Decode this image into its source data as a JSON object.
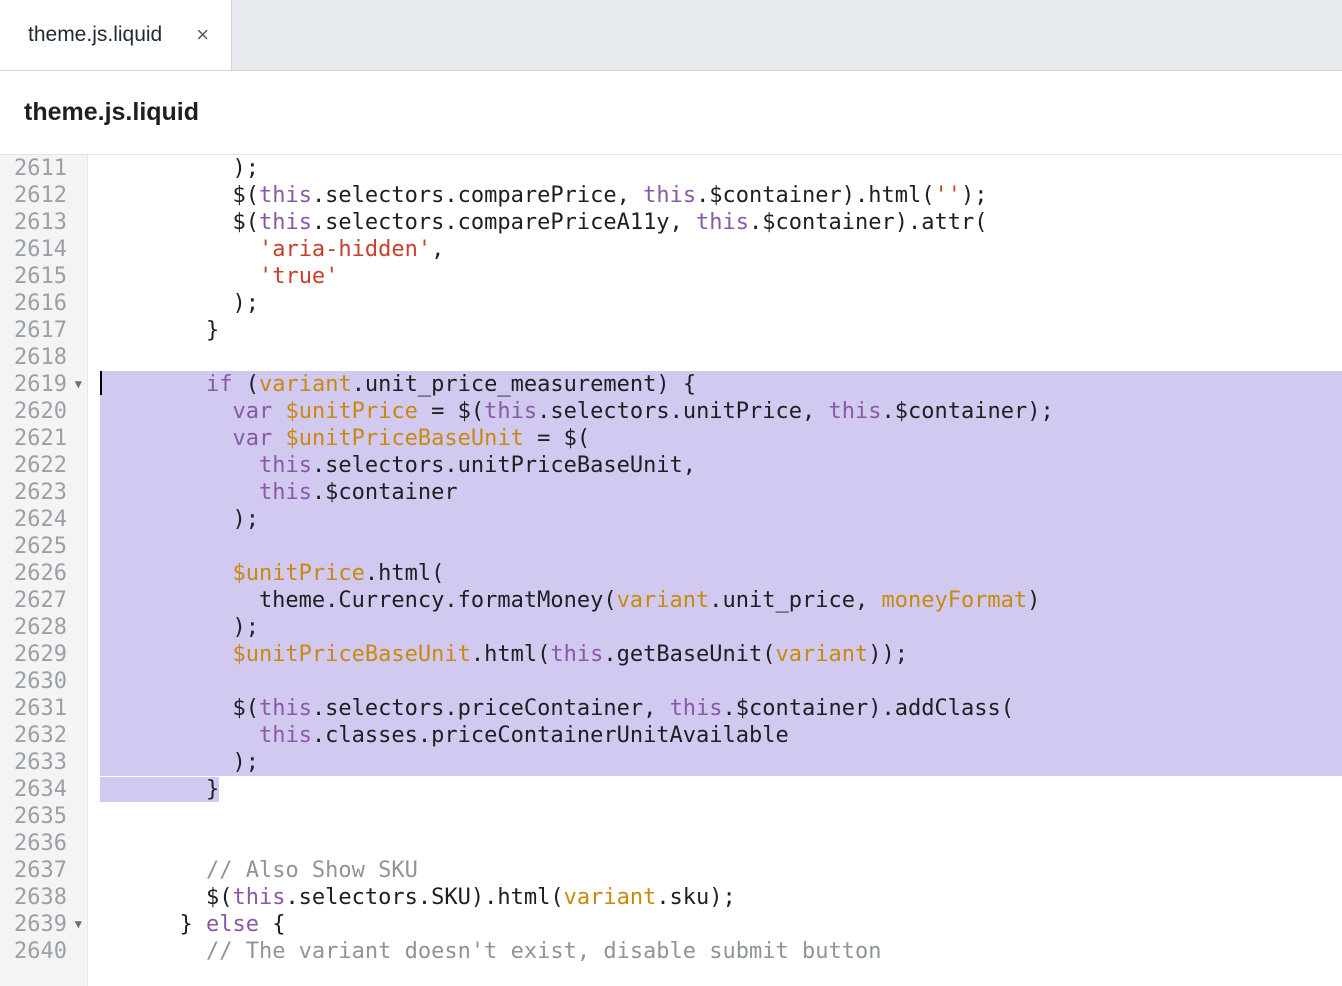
{
  "tab": {
    "label": "theme.js.liquid",
    "close_glyph": "×"
  },
  "file": {
    "title": "theme.js.liquid"
  },
  "gutter": {
    "start": 2611,
    "fold_lines": [
      2619,
      2639
    ],
    "count": 30
  },
  "highlight": {
    "from": 2619,
    "to": 2634
  },
  "code": {
    "l2611": "          );",
    "l2612_a": "          $(",
    "l2612_this": "this",
    "l2612_b": ".selectors.comparePrice, ",
    "l2612_this2": "this",
    "l2612_c": ".$container).html(",
    "l2612_str": "''",
    "l2612_d": ");",
    "l2613_a": "          $(",
    "l2613_this": "this",
    "l2613_b": ".selectors.comparePriceA11y, ",
    "l2613_this2": "this",
    "l2613_c": ".$container).attr(",
    "l2614_a": "            ",
    "l2614_str": "'aria-hidden'",
    "l2614_b": ",",
    "l2615_a": "            ",
    "l2615_str": "'true'",
    "l2616": "          );",
    "l2617": "        }",
    "l2618": "",
    "l2619_a": "        ",
    "l2619_kw": "if",
    "l2619_b": " (",
    "l2619_var": "variant",
    "l2619_c": ".unit_price_measurement) {",
    "l2620_a": "          ",
    "l2620_kw": "var",
    "l2620_b": " ",
    "l2620_id": "$unitPrice",
    "l2620_c": " = $(",
    "l2620_this": "this",
    "l2620_d": ".selectors.unitPrice, ",
    "l2620_this2": "this",
    "l2620_e": ".$container);",
    "l2621_a": "          ",
    "l2621_kw": "var",
    "l2621_b": " ",
    "l2621_id": "$unitPriceBaseUnit",
    "l2621_c": " = $(",
    "l2622_a": "            ",
    "l2622_this": "this",
    "l2622_b": ".selectors.unitPriceBaseUnit,",
    "l2623_a": "            ",
    "l2623_this": "this",
    "l2623_b": ".$container",
    "l2624": "          );",
    "l2625": "",
    "l2626_a": "          ",
    "l2626_id": "$unitPrice",
    "l2626_b": ".html(",
    "l2627_a": "            theme.Currency.formatMoney(",
    "l2627_var": "variant",
    "l2627_b": ".unit_price, ",
    "l2627_id": "moneyFormat",
    "l2627_c": ")",
    "l2628": "          );",
    "l2629_a": "          ",
    "l2629_id": "$unitPriceBaseUnit",
    "l2629_b": ".html(",
    "l2629_this": "this",
    "l2629_c": ".getBaseUnit(",
    "l2629_var": "variant",
    "l2629_d": "));",
    "l2630": "",
    "l2631_a": "          $(",
    "l2631_this": "this",
    "l2631_b": ".selectors.priceContainer, ",
    "l2631_this2": "this",
    "l2631_c": ".$container).addClass(",
    "l2632_a": "            ",
    "l2632_this": "this",
    "l2632_b": ".classes.priceContainerUnitAvailable",
    "l2633": "          );",
    "l2634": "        }",
    "l2635": "",
    "l2636": "",
    "l2637_a": "        ",
    "l2637_cmt": "// Also Show SKU",
    "l2638_a": "        $(",
    "l2638_this": "this",
    "l2638_b": ".selectors.SKU).html(",
    "l2638_var": "variant",
    "l2638_c": ".sku);",
    "l2639_a": "      } ",
    "l2639_kw": "else",
    "l2639_b": " {",
    "l2640_a": "        ",
    "l2640_cmt": "// The variant doesn't exist, disable submit button"
  }
}
